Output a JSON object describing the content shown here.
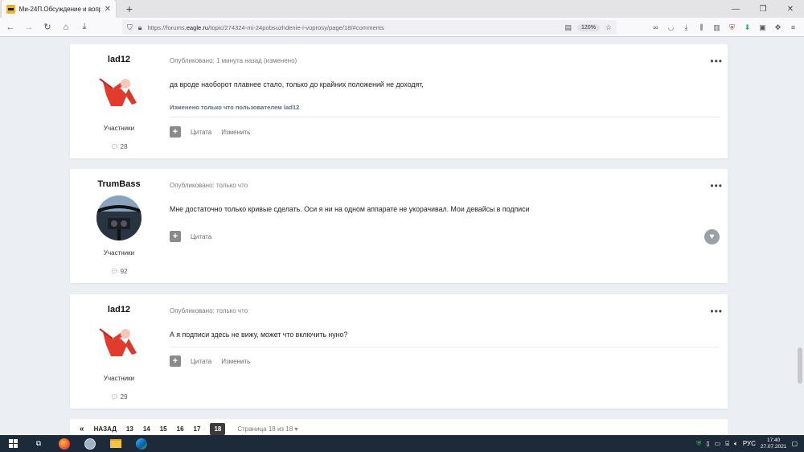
{
  "browser": {
    "tab_title": "Ми-24П.Обсуждение и вопро...",
    "url_prefix": "https://forums.",
    "url_domain": "eagle.ru",
    "url_path": "/topic/274324-mi-24pobsuzhdenie-i-voprosy/page/18/#comments",
    "zoom": "120%"
  },
  "posts": [
    {
      "author": "lad12",
      "role": "Участники",
      "count": "28",
      "meta": "Опубликовано: 1 минута назад (изменено)",
      "text": "да вроде наоборот плавнее стало, только до крайних положений не доходят,",
      "edited": "Изменено только что пользователем lad12",
      "quote": "Цитата",
      "edit": "Изменить"
    },
    {
      "author": "TrumBass",
      "role": "Участники",
      "count": "92",
      "meta": "Опубликовано: только что",
      "text": "Мне достаточно только кривые сделать. Оси я ни на одном аппарате не укорачивал. Мои девайсы в подписи",
      "quote": "Цитата"
    },
    {
      "author": "lad12",
      "role": "Участники",
      "count": "29",
      "meta": "Опубликовано: только что",
      "text": "А я подписи здесь не вижу, может что включить нуно?",
      "quote": "Цитата",
      "edit": "Изменить"
    }
  ],
  "pagination": {
    "first": "«",
    "prev": "НАЗАД",
    "pages": [
      "13",
      "14",
      "15",
      "16",
      "17"
    ],
    "current": "18",
    "info": "Страница 18 из 18 ▾"
  },
  "taskbar": {
    "lang": "РУС",
    "time": "17:40",
    "date": "27.07.2021"
  }
}
